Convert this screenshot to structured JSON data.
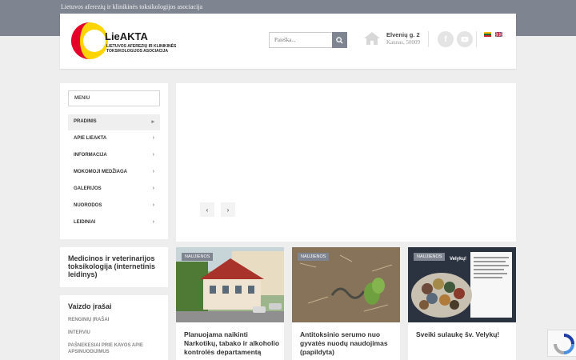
{
  "topbar": {
    "org_name": "Lietuvos aferezių ir klinikinės toksikologijos asociacija"
  },
  "header": {
    "logo_title": "LieAKTA",
    "logo_subtitle": "LIETUVOS AFEREZIŲ IR KLINIKINĖS TOKSIKOLOGIJOS ASOCIACIJA",
    "search_placeholder": "Paieška...",
    "address_line1": "Elvenių g. 2",
    "address_line2": "Kaunas, 50009",
    "social": [
      "facebook-icon",
      "youtube-icon"
    ],
    "languages": [
      "lt",
      "en"
    ]
  },
  "menu": {
    "label": "MENIU",
    "items": [
      {
        "label": "PRADINIS",
        "active": true
      },
      {
        "label": "APIE LIEAKTA",
        "active": false
      },
      {
        "label": "INFORMACIJA",
        "active": false
      },
      {
        "label": "MOKOMOJI MEDŽIAGA",
        "active": false
      },
      {
        "label": "GALERIJOS",
        "active": false
      },
      {
        "label": "NUORODOS",
        "active": false
      },
      {
        "label": "LEIDINIAI",
        "active": false
      }
    ]
  },
  "slider": {
    "prev": "‹",
    "next": "›"
  },
  "sidebar": {
    "publication_title": "Medicinos ir veterinarijos toksikologija (internetinis leidinys)",
    "video_title": "Vaizdo įrašai",
    "video_links": [
      "RENGINIŲ ĮRAŠAI",
      "INTERVIU",
      "PAŠNEKESIAI PRIE KAVOS APIE APSINUODIJIMUS"
    ]
  },
  "news": [
    {
      "badge": "NAUJIENOS",
      "title": "Planuojama naikinti Narkotikų, tabako ir alkoholio kontrolės departamentą"
    },
    {
      "badge": "NAUJIENOS",
      "title": "Antitoksinio serumo nuo gyvatės nuodų naudojimas (papildyta)"
    },
    {
      "badge": "NAUJIENOS",
      "title": "Sveiki sulaukę šv. Velykų!",
      "img_heading": "Velykų!"
    }
  ],
  "colors": {
    "topbar": "#7e8490",
    "page_bg": "#eeeeee",
    "logo_red": "#e4002b",
    "logo_yellow": "#ffd400"
  }
}
